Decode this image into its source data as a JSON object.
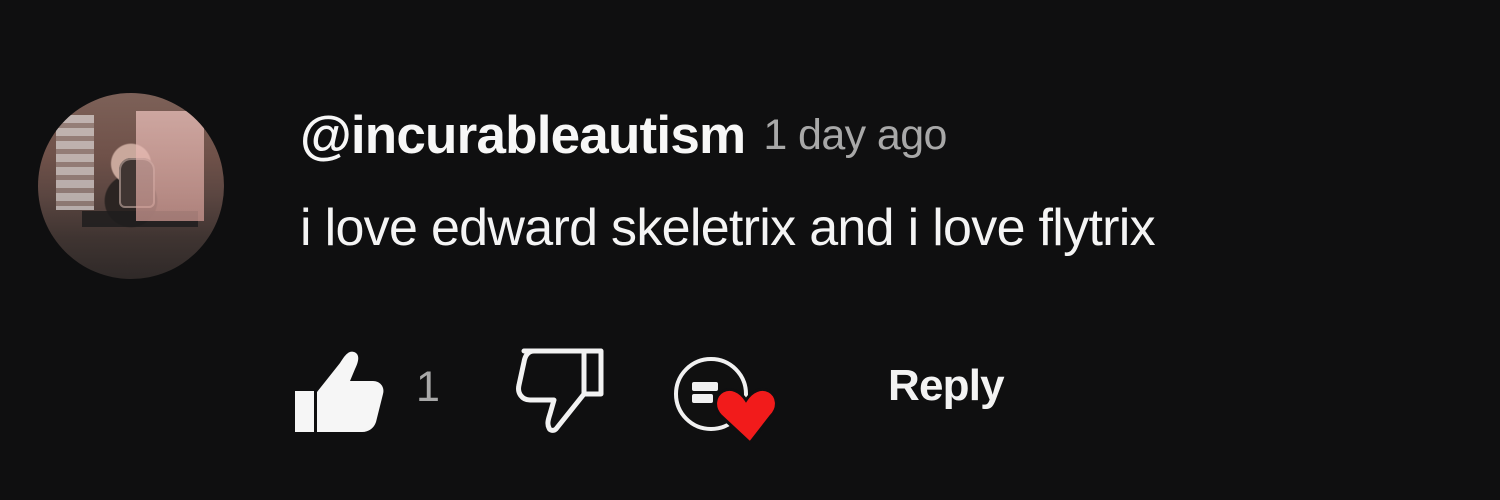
{
  "comment": {
    "username": "@incurableautism",
    "timestamp": "1 day ago",
    "text": "i love edward skeletrix and i love flytrix",
    "like_count": "1",
    "reply_label": "Reply"
  },
  "icons": {
    "like": "thumbs-up-icon",
    "dislike": "thumbs-down-icon",
    "creator_heart": "creator-heart-icon"
  },
  "colors": {
    "background": "#0f0f10",
    "primary_text": "#f4f4f4",
    "secondary_text": "#a8a8a8",
    "heart": "#f21b1b"
  }
}
